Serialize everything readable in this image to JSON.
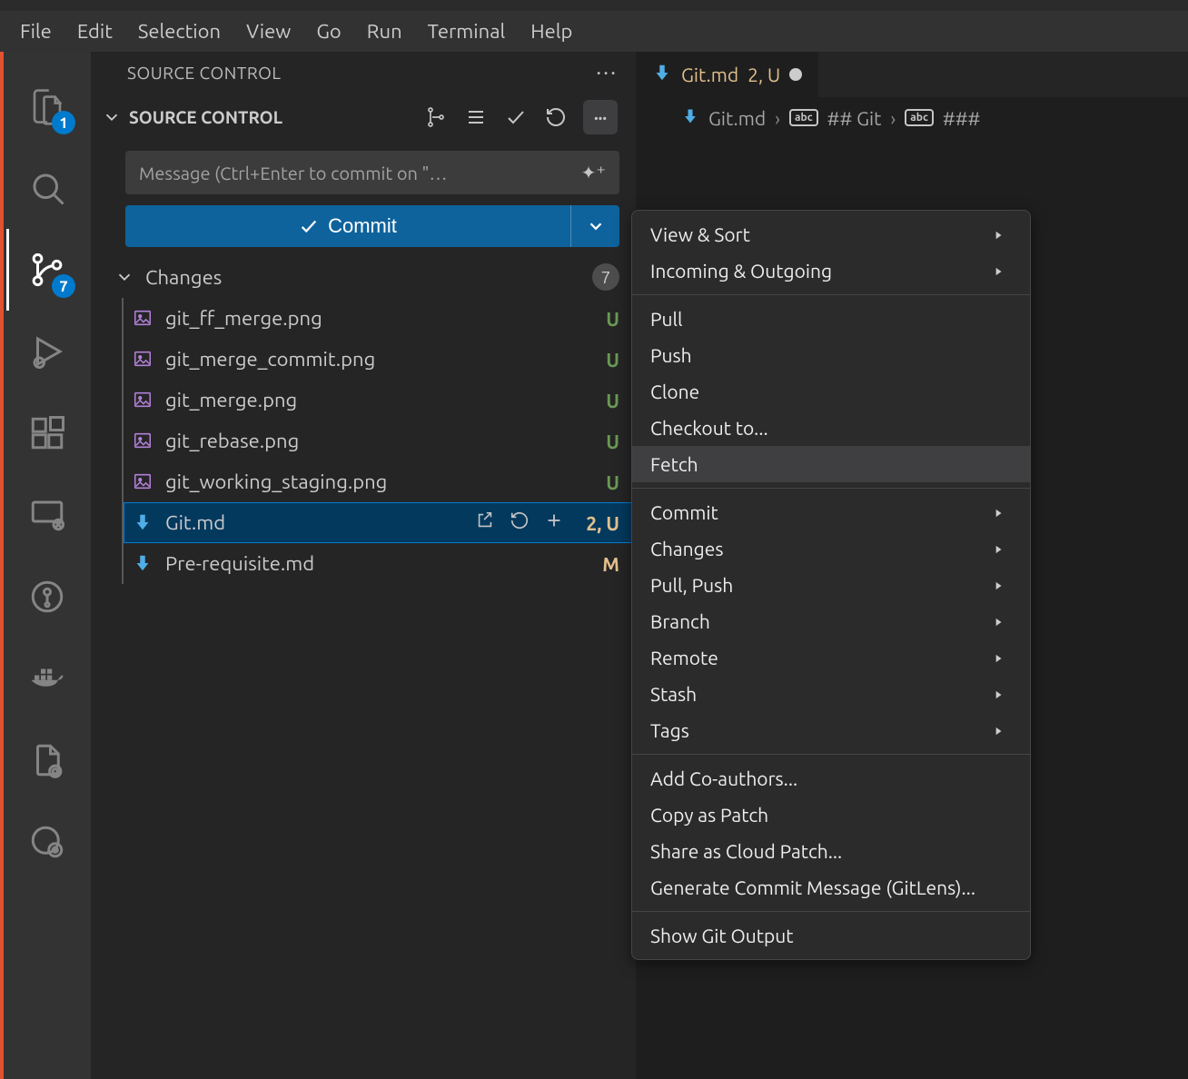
{
  "menubar": {
    "items": [
      "File",
      "Edit",
      "Selection",
      "View",
      "Go",
      "Run",
      "Terminal",
      "Help"
    ]
  },
  "activity_bar": {
    "explorer_badge": "1",
    "scm_badge": "7"
  },
  "sidebar": {
    "title": "SOURCE CONTROL",
    "section_title": "SOURCE CONTROL",
    "commit_placeholder": "Message (Ctrl+Enter to commit on \"…",
    "commit_button": "Commit",
    "changes_label": "Changes",
    "changes_count": "7",
    "files": [
      {
        "name": "git_ff_merge.png",
        "status": "U",
        "icon": "image",
        "selected": false
      },
      {
        "name": "git_merge_commit.png",
        "status": "U",
        "icon": "image",
        "selected": false
      },
      {
        "name": "git_merge.png",
        "status": "U",
        "icon": "image",
        "selected": false
      },
      {
        "name": "git_rebase.png",
        "status": "U",
        "icon": "image",
        "selected": false
      },
      {
        "name": "git_working_staging.png",
        "status": "U",
        "icon": "image",
        "selected": false
      },
      {
        "name": "Git.md",
        "status": "2, U",
        "icon": "md",
        "selected": true
      },
      {
        "name": "Pre-requisite.md",
        "status": "M",
        "icon": "md",
        "selected": false
      }
    ]
  },
  "editor": {
    "tab": {
      "name": "Git.md",
      "mods": "2, U"
    },
    "breadcrumbs": [
      {
        "type": "file",
        "label": "Git.md"
      },
      {
        "type": "symbol",
        "label": "## Git"
      },
      {
        "type": "symbol",
        "label": "### "
      }
    ]
  },
  "context_menu": {
    "groups": [
      [
        {
          "label": "View & Sort",
          "submenu": true
        },
        {
          "label": "Incoming & Outgoing",
          "submenu": true
        }
      ],
      [
        {
          "label": "Pull"
        },
        {
          "label": "Push"
        },
        {
          "label": "Clone"
        },
        {
          "label": "Checkout to..."
        },
        {
          "label": "Fetch",
          "hover": true
        }
      ],
      [
        {
          "label": "Commit",
          "submenu": true
        },
        {
          "label": "Changes",
          "submenu": true
        },
        {
          "label": "Pull, Push",
          "submenu": true
        },
        {
          "label": "Branch",
          "submenu": true
        },
        {
          "label": "Remote",
          "submenu": true
        },
        {
          "label": "Stash",
          "submenu": true
        },
        {
          "label": "Tags",
          "submenu": true
        }
      ],
      [
        {
          "label": "Add Co-authors..."
        },
        {
          "label": "Copy as Patch"
        },
        {
          "label": "Share as Cloud Patch..."
        },
        {
          "label": "Generate Commit Message (GitLens)..."
        }
      ],
      [
        {
          "label": "Show Git Output"
        }
      ]
    ]
  }
}
